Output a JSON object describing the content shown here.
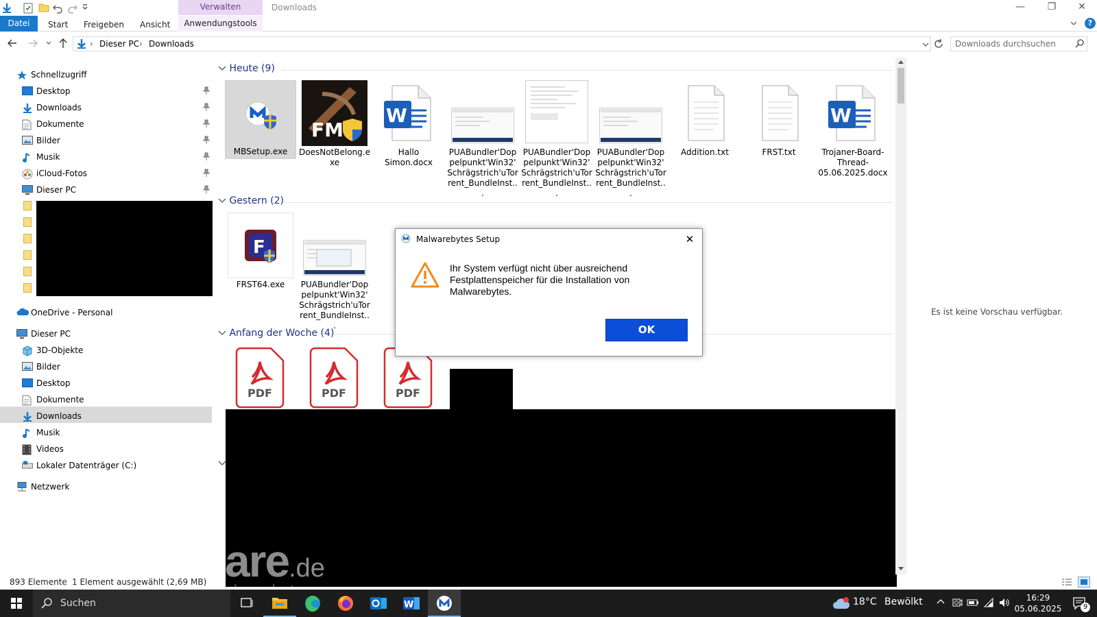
{
  "ribbon": {
    "context_label": "Verwalten",
    "window_title": "Downloads",
    "tabs": [
      "Datei",
      "Start",
      "Freigeben",
      "Ansicht",
      "Anwendungstools"
    ],
    "controls": {
      "minimize": "—",
      "restore": "❐",
      "close": "✕"
    }
  },
  "address": {
    "crumbs": [
      "Dieser PC",
      "Downloads"
    ],
    "search_placeholder": "Downloads durchsuchen"
  },
  "nav": {
    "quick_access": "Schnellzugriff",
    "quick_items": [
      "Desktop",
      "Downloads",
      "Dokumente",
      "Bilder",
      "Musik",
      "iCloud-Fotos",
      "Dieser PC"
    ],
    "onedrive": "OneDrive - Personal",
    "this_pc": "Dieser PC",
    "pc_items": [
      "3D-Objekte",
      "Bilder",
      "Desktop",
      "Dokumente",
      "Downloads",
      "Musik",
      "Videos",
      "Lokaler Datenträger (C:)"
    ],
    "network": "Netzwerk"
  },
  "groups": {
    "today": "Heute (9)",
    "yesterday": "Gestern (2)",
    "week": "Anfang der Woche (4)"
  },
  "files_today": [
    "MBSetup.exe",
    "DoesNotBelong.exe",
    "Hallo Simon.docx",
    "PUABundler'Doppelpunkt'Win32'Schrägstrich'uTorrent_BundleInst...",
    "PUABundler'Doppelpunkt'Win32'Schrägstrich'uTorrent_BundleInst...",
    "PUABundler'Doppelpunkt'Win32'Schrägstrich'uTorrent_BundleInst...",
    "Addition.txt",
    "FRST.txt",
    "Trojaner-Board-Thread-05.06.2025.docx"
  ],
  "files_yesterday": [
    "FRST64.exe",
    "PUABundler'Doppelpunkt'Win32'Schrägstrich'uTorrent_BundleInst..."
  ],
  "pdf_label": "PDF",
  "dialog": {
    "title": "Malwarebytes Setup",
    "message": "Ihr System verfügt nicht über ausreichend Festplattenspeicher für die Installation von Malwarebytes.",
    "ok": "OK"
  },
  "preview_text": "Es ist keine Vorschau verfügbar.",
  "status": {
    "count": "893 Elemente",
    "selection": "1 Element ausgewählt (2,69 MB)"
  },
  "watermark": {
    "big": "are",
    "tld": ".de",
    "sub": "part of deutscher-chat"
  },
  "taskbar": {
    "search": "Suchen",
    "weather": "18°C",
    "weather_text": "Bewölkt",
    "time": "16:29",
    "date": "05.06.2025",
    "notif_count": "9"
  },
  "colors": {
    "accent": "#1979ca",
    "dialog_button": "#0b4fd6",
    "group_header": "#1e3287"
  }
}
